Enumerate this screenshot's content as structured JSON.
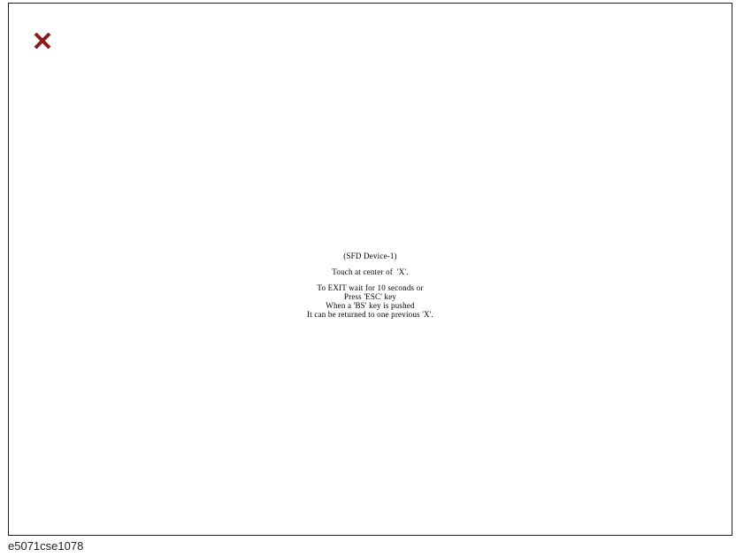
{
  "screen": {
    "target_icon": "x-mark-icon",
    "target_color": "#8b1a1a",
    "message": {
      "title": "(SFD Device-1)",
      "instruction": "Touch at center of  'X'.",
      "exit_line_1": "To EXIT wait for 10 seconds or",
      "exit_line_2": "Press 'ESC' key",
      "bs_line_1": "When a 'BS' key is pushed",
      "bs_line_2": "It can be returned to one previous 'X'."
    }
  },
  "caption": "e5071cse1078"
}
